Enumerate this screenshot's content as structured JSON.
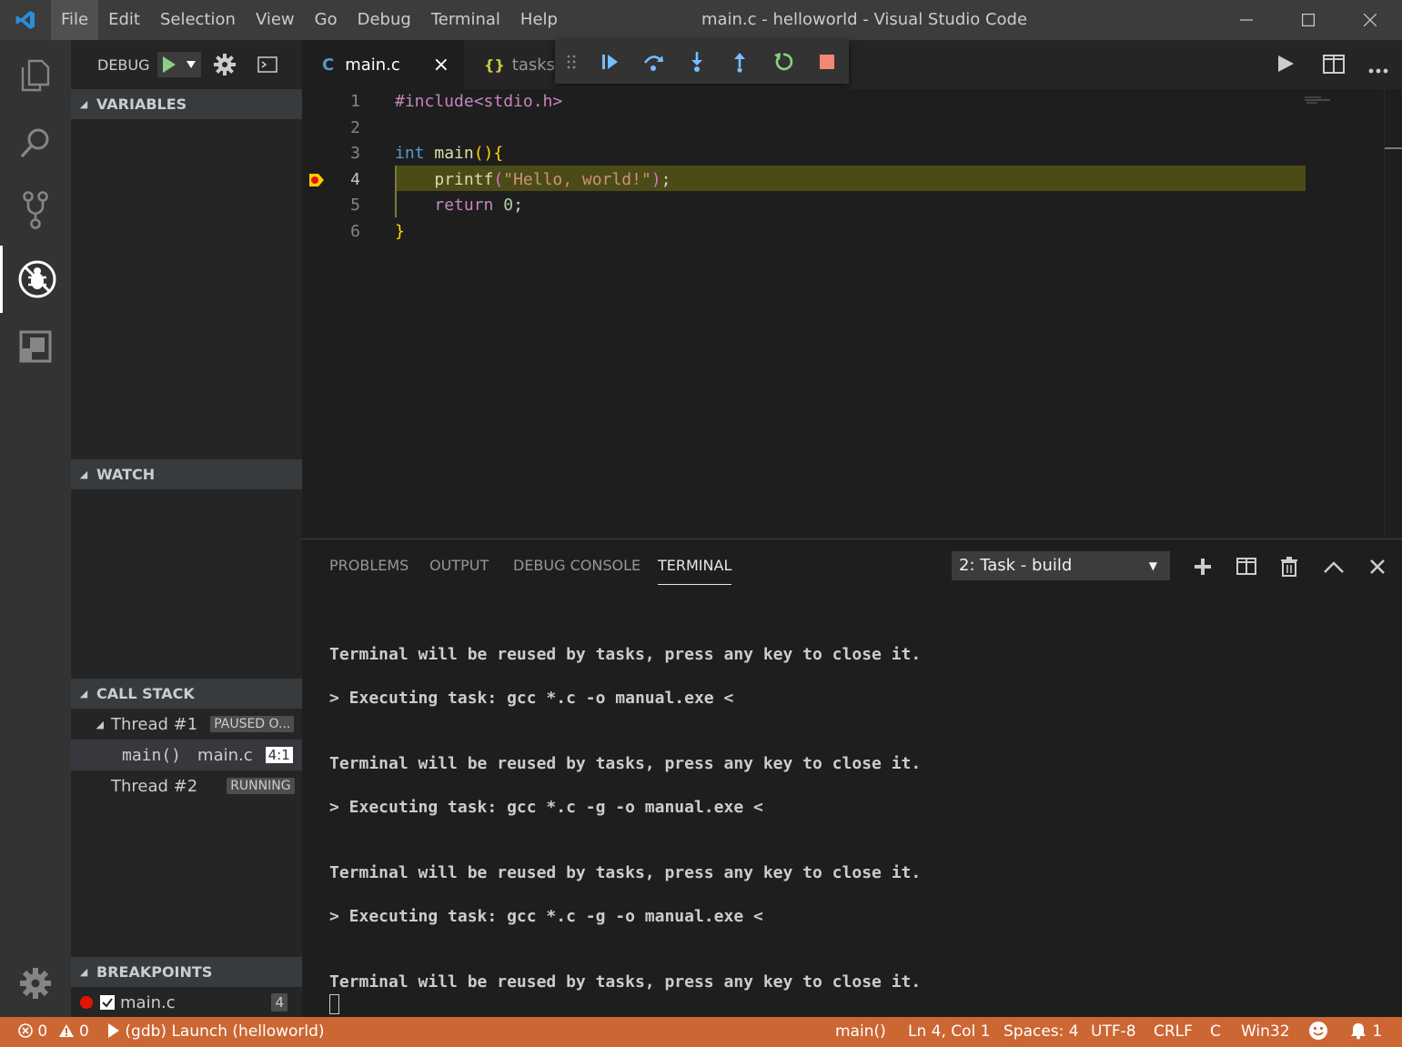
{
  "window": {
    "title": "main.c - helloworld - Visual Studio Code",
    "menu": [
      "File",
      "Edit",
      "Selection",
      "View",
      "Go",
      "Debug",
      "Terminal",
      "Help"
    ]
  },
  "sidebar": {
    "debug_label": "DEBUG",
    "variables_title": "VARIABLES",
    "watch_title": "WATCH",
    "callstack_title": "CALL STACK",
    "breakpoints_title": "BREAKPOINTS",
    "threads": [
      {
        "name": "Thread #1",
        "state": "PAUSED O..."
      },
      {
        "name": "Thread #2",
        "state": "RUNNING"
      }
    ],
    "frame": {
      "fn": "main()",
      "file": "main.c",
      "pos": "4:1"
    },
    "breakpoint": {
      "file": "main.c",
      "line": "4"
    }
  },
  "tabs": [
    {
      "icon": "C",
      "label": "main.c",
      "close": "×"
    },
    {
      "icon": "{}",
      "label": "tasks.j"
    }
  ],
  "code": {
    "lines": [
      {
        "n": "1",
        "text": "#include<stdio.h>"
      },
      {
        "n": "2",
        "text": ""
      },
      {
        "n": "3",
        "text": "int main(){"
      },
      {
        "n": "4",
        "text": "    printf(\"Hello, world!\");"
      },
      {
        "n": "5",
        "text": "    return 0;"
      },
      {
        "n": "6",
        "text": "}"
      }
    ]
  },
  "panel": {
    "tabs": [
      "PROBLEMS",
      "OUTPUT",
      "DEBUG CONSOLE",
      "TERMINAL"
    ],
    "terminal_select": "2: Task - build",
    "select_arrow": "▼",
    "terminal_lines": [
      "Terminal will be reused by tasks, press any key to close it.",
      "> Executing task: gcc *.c -o manual.exe <",
      "Terminal will be reused by tasks, press any key to close it.",
      "> Executing task: gcc *.c -g -o manual.exe <",
      "Terminal will be reused by tasks, press any key to close it.",
      "> Executing task: gcc *.c -g -o manual.exe <",
      "Terminal will be reused by tasks, press any key to close it."
    ]
  },
  "statusbar": {
    "errors": "0",
    "warnings": "0",
    "launch": "(gdb) Launch (helloworld)",
    "function": "main()",
    "position": "Ln 4, Col 1",
    "spaces": "Spaces: 4",
    "encoding": "UTF-8",
    "eol": "CRLF",
    "language": "C",
    "platform": "Win32",
    "notifications": "1"
  },
  "colors": {
    "statusbar": "#cc6633",
    "current_line": "#4b4b18",
    "keyword": "#569cd6",
    "string": "#ce9178",
    "function": "#dcdcaa",
    "control": "#c586c0"
  }
}
